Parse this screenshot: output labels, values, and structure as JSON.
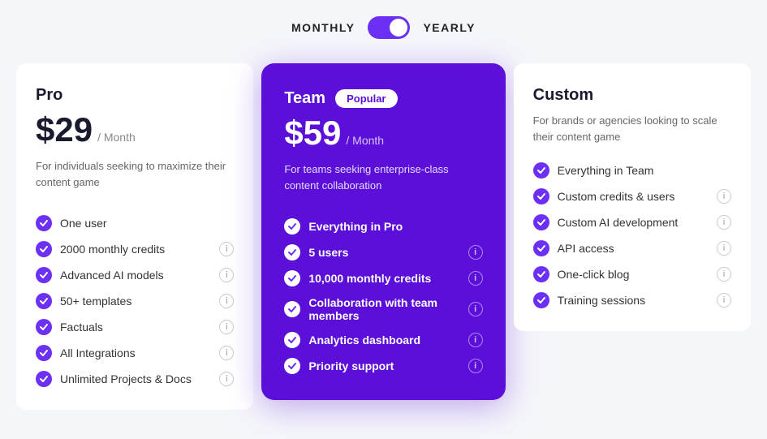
{
  "billing": {
    "monthly_label": "MONTHLY",
    "yearly_label": "YEARLY",
    "toggle_active": "yearly"
  },
  "plans": [
    {
      "id": "pro",
      "name": "Pro",
      "price": "$29",
      "period": "/ Month",
      "description": "For individuals seeking to maximize their content game",
      "popular": false,
      "features": [
        {
          "text": "One user",
          "has_info": false
        },
        {
          "text": "2000 monthly credits",
          "has_info": true
        },
        {
          "text": "Advanced AI models",
          "has_info": true
        },
        {
          "text": "50+ templates",
          "has_info": true
        },
        {
          "text": "Factuals",
          "has_info": true
        },
        {
          "text": "All Integrations",
          "has_info": true
        },
        {
          "text": "Unlimited Projects & Docs",
          "has_info": true
        }
      ]
    },
    {
      "id": "team",
      "name": "Team",
      "price": "$59",
      "period": "/ Month",
      "description": "For teams seeking enterprise-class content collaboration",
      "popular": true,
      "popular_label": "Popular",
      "features": [
        {
          "text": "Everything in Pro",
          "has_info": false
        },
        {
          "text": "5 users",
          "has_info": true
        },
        {
          "text": "10,000 monthly credits",
          "has_info": true
        },
        {
          "text": "Collaboration with team members",
          "has_info": true
        },
        {
          "text": "Analytics dashboard",
          "has_info": true
        },
        {
          "text": "Priority support",
          "has_info": true
        }
      ]
    },
    {
      "id": "custom",
      "name": "Custom",
      "price": "",
      "period": "",
      "description": "For brands or agencies looking to scale their content game",
      "popular": false,
      "features": [
        {
          "text": "Everything in Team",
          "has_info": false
        },
        {
          "text": "Custom credits & users",
          "has_info": true
        },
        {
          "text": "Custom AI development",
          "has_info": true
        },
        {
          "text": "API access",
          "has_info": true
        },
        {
          "text": "One-click blog",
          "has_info": true
        },
        {
          "text": "Training sessions",
          "has_info": true
        }
      ]
    }
  ],
  "icons": {
    "check": "✓",
    "info": "i"
  }
}
